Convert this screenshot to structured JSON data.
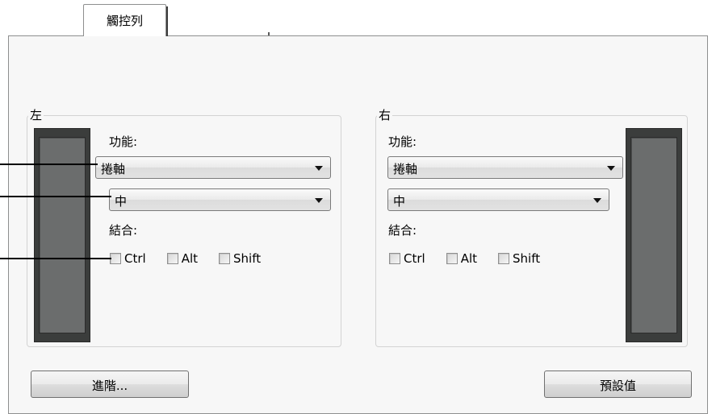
{
  "tab": {
    "label": "觸控列"
  },
  "left": {
    "title": "左",
    "function_label": "功能:",
    "function_value": "捲軸",
    "speed_value": "中",
    "modifier_label": "結合:",
    "modifiers": [
      "Ctrl",
      "Alt",
      "Shift"
    ]
  },
  "right": {
    "title": "右",
    "function_label": "功能:",
    "function_value": "捲軸",
    "speed_value": "中",
    "modifier_label": "結合:",
    "modifiers": [
      "Ctrl",
      "Alt",
      "Shift"
    ]
  },
  "buttons": {
    "advanced": "進階...",
    "default": "預設值"
  }
}
